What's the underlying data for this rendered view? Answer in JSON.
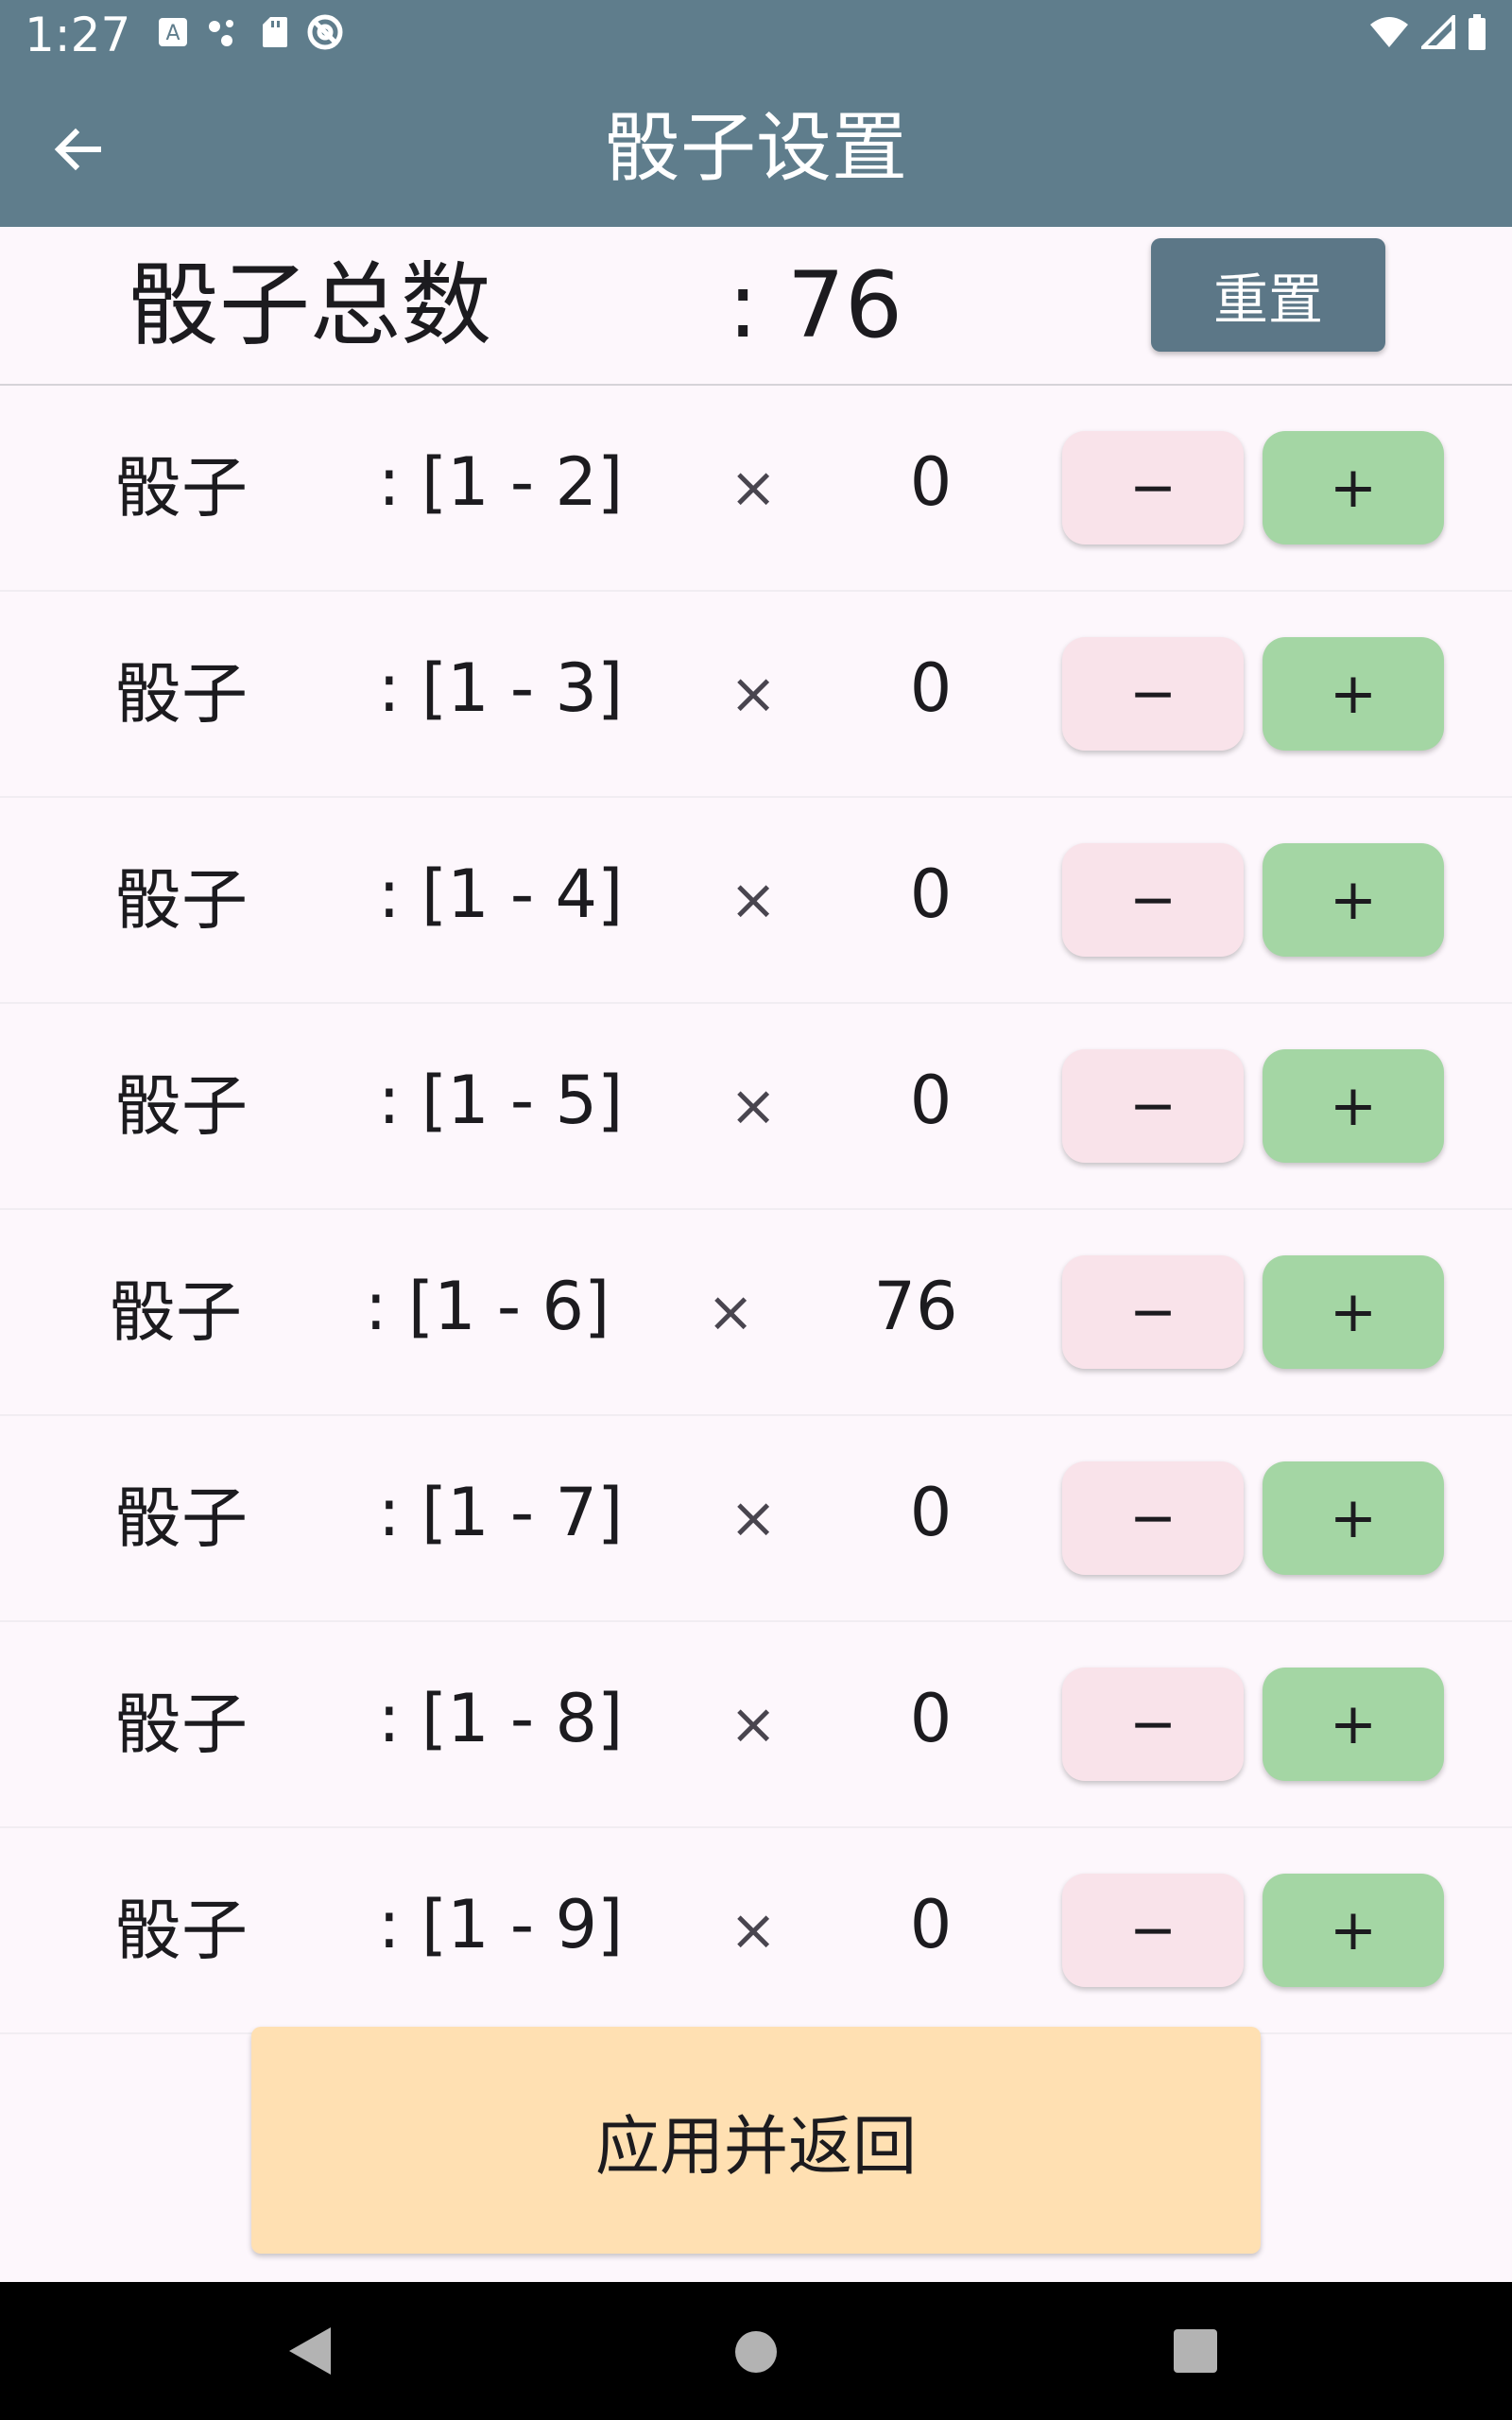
{
  "status_bar": {
    "time": "1:27",
    "left_icons": [
      "a-keyboard-icon",
      "dots-icon",
      "sd-card-icon",
      "at-sign-icon"
    ],
    "right_icons": [
      "wifi-icon",
      "signal-icon",
      "battery-icon"
    ]
  },
  "app_bar": {
    "title": "骰子设置",
    "back_icon": "arrow-left-icon"
  },
  "summary": {
    "label": "骰子总数",
    "value": ": 76",
    "reset_label": "重置"
  },
  "dice": [
    {
      "name": "骰子",
      "range": ": [1 - 2]",
      "times": "×",
      "count": "0",
      "minus": "−",
      "plus": "+"
    },
    {
      "name": "骰子",
      "range": ": [1 - 3]",
      "times": "×",
      "count": "0",
      "minus": "−",
      "plus": "+"
    },
    {
      "name": "骰子",
      "range": ": [1 - 4]",
      "times": "×",
      "count": "0",
      "minus": "−",
      "plus": "+"
    },
    {
      "name": "骰子",
      "range": ": [1 - 5]",
      "times": "×",
      "count": "0",
      "minus": "−",
      "plus": "+"
    },
    {
      "name": "骰子",
      "range": ": [1 - 6]",
      "times": "×",
      "count": "76",
      "minus": "−",
      "plus": "+"
    },
    {
      "name": "骰子",
      "range": ": [1 - 7]",
      "times": "×",
      "count": "0",
      "minus": "−",
      "plus": "+"
    },
    {
      "name": "骰子",
      "range": ": [1 - 8]",
      "times": "×",
      "count": "0",
      "minus": "−",
      "plus": "+"
    },
    {
      "name": "骰子",
      "range": ": [1 - 9]",
      "times": "×",
      "count": "0",
      "minus": "−",
      "plus": "+"
    }
  ],
  "apply_label": "应用并返回",
  "colors": {
    "app_bar": "#5f7d8c",
    "reset_button": "#5c7787",
    "minus_button": "#f9e3ea",
    "plus_button": "#a4d6a4",
    "apply_button": "#ffe0b2",
    "background": "#fdf7fc"
  },
  "nav_bar": {
    "icons": [
      "nav-back-icon",
      "nav-home-icon",
      "nav-recents-icon"
    ]
  }
}
